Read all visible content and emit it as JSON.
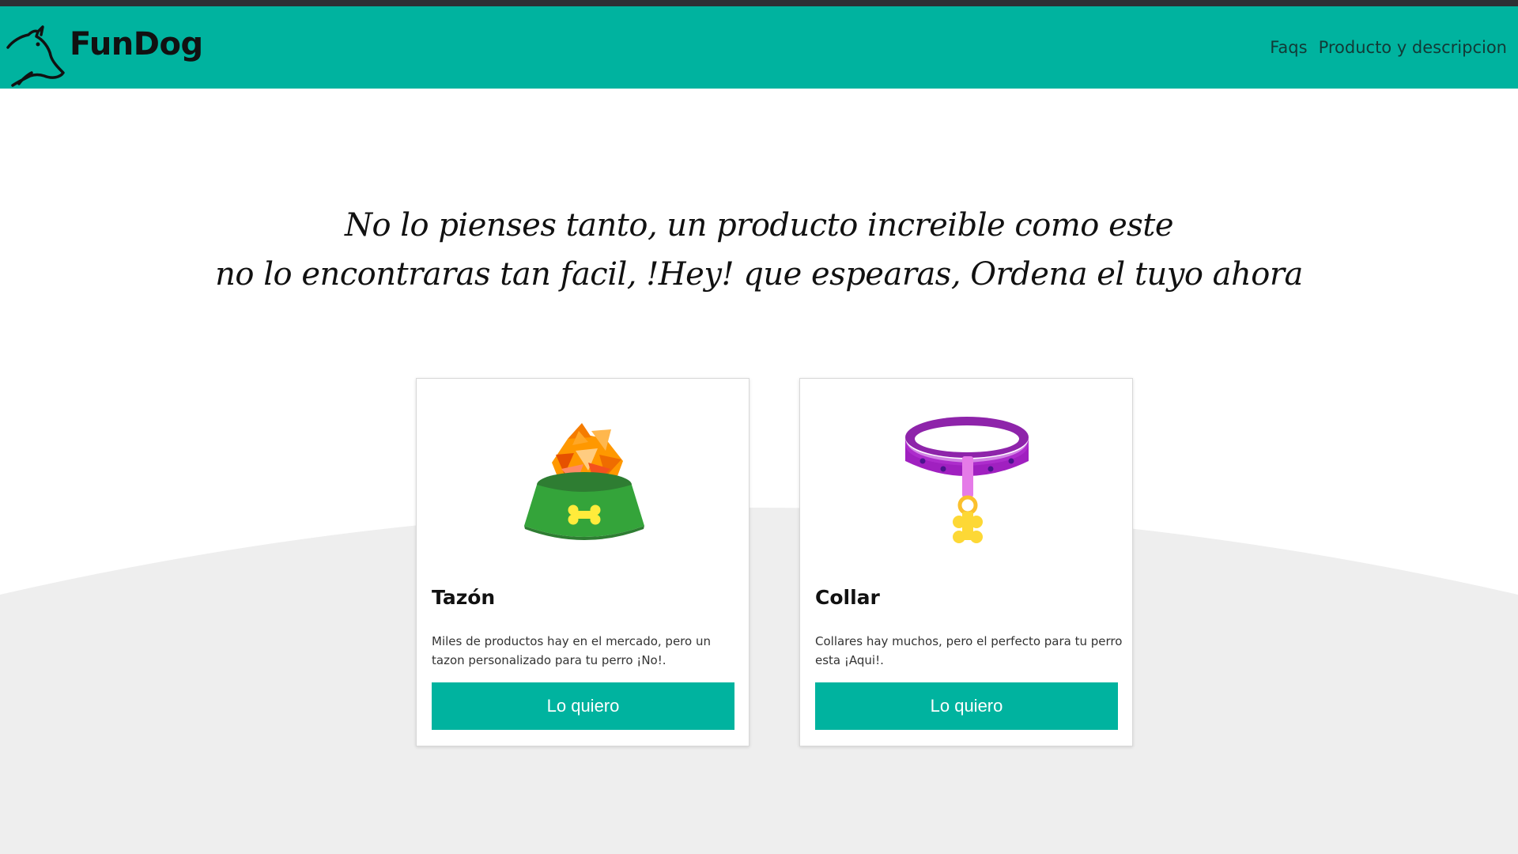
{
  "header": {
    "brand": "FunDog",
    "nav": [
      {
        "label": "Faqs"
      },
      {
        "label": "Producto y descripcion"
      }
    ]
  },
  "hero": {
    "line1": "No lo pienses tanto, un producto increible como este",
    "line2": "no lo encontraras tan facil, !Hey! que espearas, Ordena el tuyo ahora"
  },
  "products": [
    {
      "title": "Tazón",
      "description": "Miles de productos hay en el mercado, pero un tazon personalizado para tu perro ¡No!.",
      "button": "Lo quiero",
      "icon": "dog-bowl-icon"
    },
    {
      "title": "Collar",
      "description": "Collares hay muchos, pero el perfecto para tu perro esta ¡Aqui!.",
      "button": "Lo quiero",
      "icon": "dog-collar-icon"
    }
  ],
  "colors": {
    "accent": "#00b39f",
    "top_strip": "#2d3034",
    "background_curve": "#eeeeee"
  }
}
